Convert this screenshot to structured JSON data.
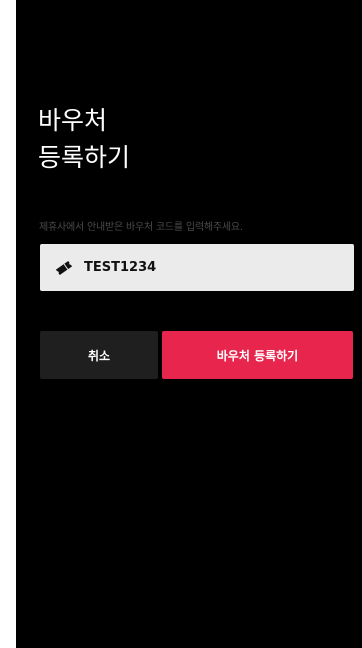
{
  "screen": {
    "title_line1": "바우처",
    "title_line2": "등록하기",
    "hint": "제휴사에서 안내받은 바우처 코드를 입력해주세요.",
    "voucher_field": {
      "value": "TEST1234",
      "icon": "ticket-icon"
    },
    "buttons": {
      "cancel_label": "취소",
      "register_label": "바우처 등록하기"
    }
  },
  "colors": {
    "background": "#000000",
    "accent": "#e8264d",
    "cancel_button": "#1f1f1f",
    "input_background": "#ebebeb"
  }
}
